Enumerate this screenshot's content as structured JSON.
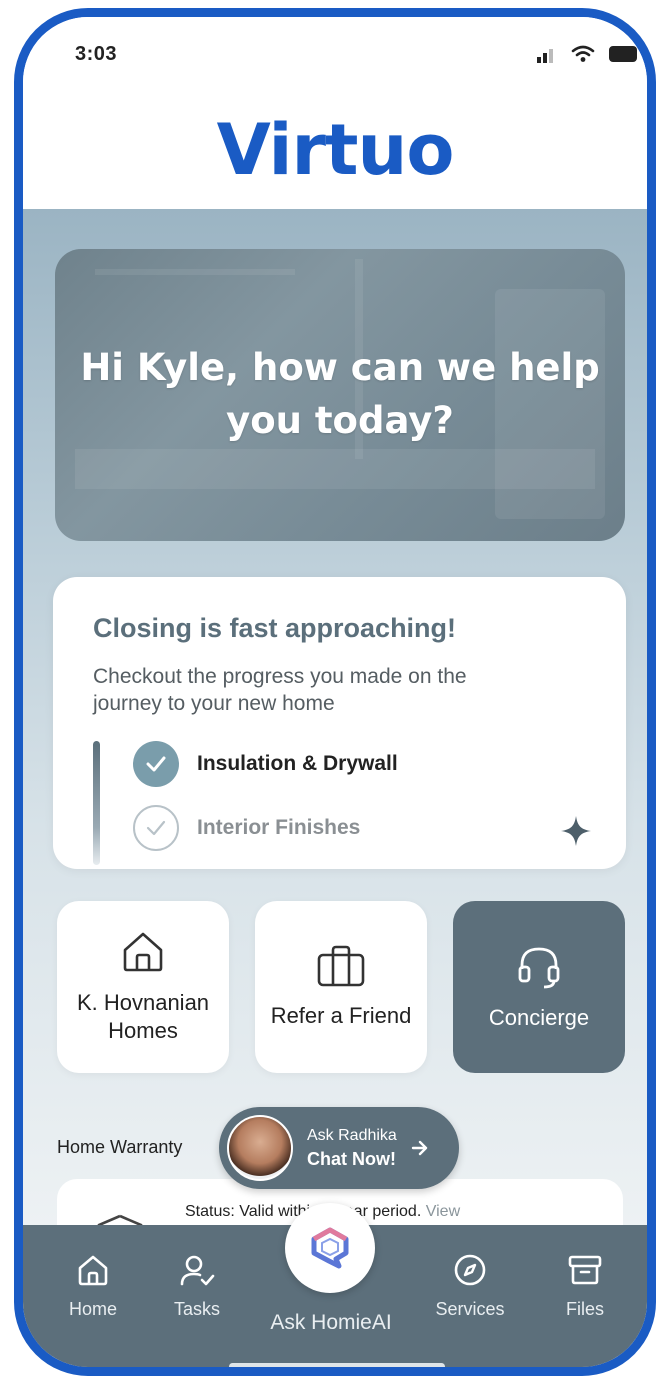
{
  "status_bar": {
    "time": "3:03"
  },
  "app": {
    "logo": "Virtuo",
    "brand_color": "#1a5bc4"
  },
  "hero": {
    "greeting": "Hi Kyle, how can we help you today?"
  },
  "closing_card": {
    "title": "Closing is fast approaching!",
    "subtitle": "Checkout the progress you made on the journey to your new home",
    "steps": [
      {
        "label": "Insulation & Drywall",
        "completed": true
      },
      {
        "label": "Interior Finishes",
        "completed": false
      }
    ]
  },
  "actions": [
    {
      "label": "K. Hovnanian Homes",
      "icon": "house-icon"
    },
    {
      "label": "Refer a Friend",
      "icon": "briefcase-icon"
    },
    {
      "label": "Concierge",
      "icon": "headset-icon"
    }
  ],
  "warranty": {
    "label": "Home Warranty",
    "status": "Status: Valid within 1 year period.",
    "view_link": "View"
  },
  "chat": {
    "ask": "Ask Radhika",
    "cta": "Chat Now!"
  },
  "tabs": {
    "home": "Home",
    "tasks": "Tasks",
    "ai": "Ask HomieAI",
    "services": "Services",
    "files": "Files"
  },
  "colors": {
    "slate": "#5c6f7b",
    "check": "#7a9dab"
  }
}
